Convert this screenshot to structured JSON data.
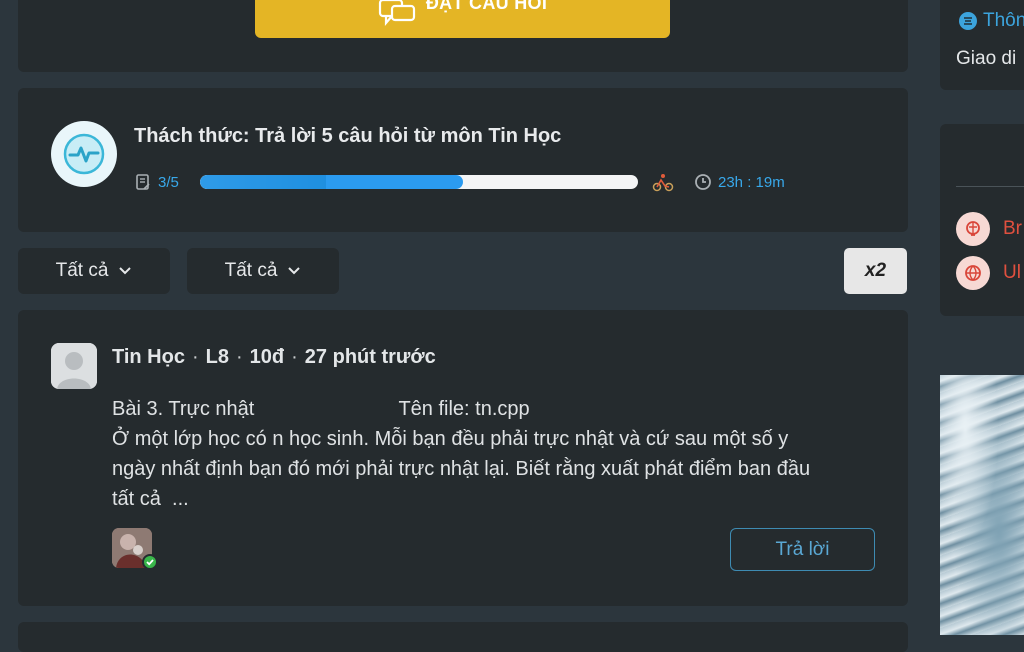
{
  "ask_button": {
    "label": "ĐẶT CÂU HỎI"
  },
  "challenge": {
    "title": "Thách thức: Trả lời 5 câu hỏi  từ môn Tin Học",
    "progress_text": "3/5",
    "progress_fraction": 0.6,
    "timer": "23h : 19m"
  },
  "filters": {
    "filter_1": "Tất cả",
    "filter_2": "Tất cả",
    "multiplier": "x2"
  },
  "question": {
    "subject": "Tin Học",
    "grade": "L8",
    "points": "10đ",
    "time_ago": "27 phút trước",
    "body_line_1": "Bài 3. Trực nhật                          Tên file: tn.cpp",
    "body_line_2": "Ở một lớp học có n học sinh. Mỗi bạn đều phải trực nhật và cứ sau một số y",
    "body_line_3": "ngày nhất định bạn đó mới phải trực nhật lại. Biết rằng xuất phát điểm ban đầu",
    "body_line_4": "tất cả  ...",
    "reply_label": "Trả lời"
  },
  "sidebar": {
    "info_label": "Thôn",
    "info_desc": "Giao di",
    "item_1": "Br",
    "item_2": "Ul"
  },
  "colors": {
    "accent_yellow": "#e4b525",
    "accent_blue": "#38a8ea",
    "danger_red": "#e0503f"
  }
}
